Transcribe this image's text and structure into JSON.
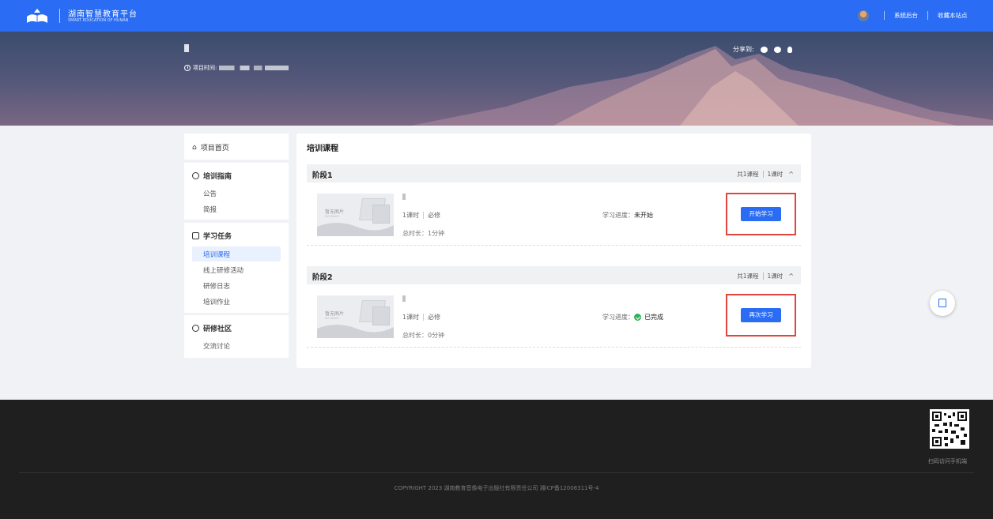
{
  "header": {
    "title": "湖南智慧教育平台",
    "subtitle": "SMART EDUCATION OF HUNAN",
    "links": [
      "系统后台",
      "收藏本站点"
    ]
  },
  "banner": {
    "time_label": "项目时间:",
    "share_label": "分享到:",
    "share_icons": [
      "wechat-icon",
      "weibo-icon",
      "qq-icon"
    ]
  },
  "sidebar": {
    "home": "项目首页",
    "sections": [
      {
        "title": "培训指南",
        "items": [
          "公告",
          "简报"
        ]
      },
      {
        "title": "学习任务",
        "items": [
          "培训课程",
          "线上研修活动",
          "研修日志",
          "培训作业"
        ],
        "active": "培训课程"
      },
      {
        "title": "研修社区",
        "items": [
          "交流讨论"
        ]
      }
    ]
  },
  "main": {
    "title": "培训课程",
    "stages": [
      {
        "name": "阶段1",
        "count": "共1课程",
        "hours": "1课时",
        "course": {
          "thumb_title": "暂无图片",
          "thumb_sub": "NO IMAGE",
          "hours": "1课时",
          "type": "必修",
          "duration": "总时长：1分钟",
          "progress_label": "学习进度：",
          "progress_status": "未开始",
          "button": "开始学习",
          "completed": false
        }
      },
      {
        "name": "阶段2",
        "count": "共1课程",
        "hours": "1课时",
        "course": {
          "thumb_title": "暂无图片",
          "thumb_sub": "NO IMAGE",
          "hours": "1课时",
          "type": "必修",
          "duration": "总时长：0分钟",
          "progress_label": "学习进度：",
          "progress_status": "已完成",
          "button": "再次学习",
          "completed": true
        }
      }
    ]
  },
  "footer": {
    "qr_caption": "扫码访问手机端",
    "copyright": "COPYRIGHT 2023 湖南教育音像电子出版社有限责任公司 湘ICP备12008311号-4"
  },
  "colors": {
    "primary": "#2a6df4",
    "highlight": "#e0463e",
    "success": "#2fb25a",
    "footer": "#1f1f1f"
  }
}
